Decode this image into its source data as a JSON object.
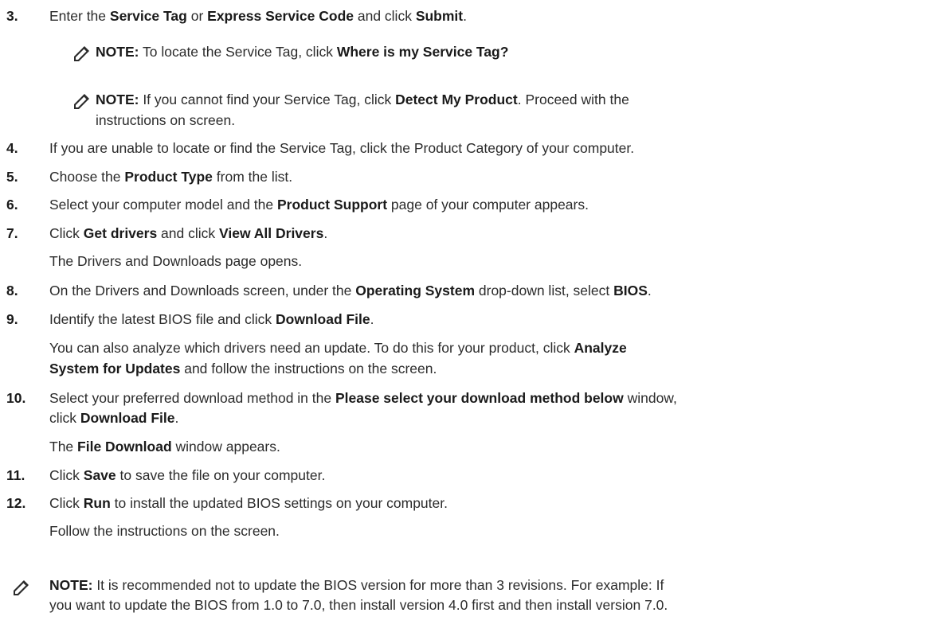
{
  "steps": {
    "s3": {
      "num": "3.",
      "pre": "Enter the ",
      "b1": "Service Tag",
      "mid1": " or ",
      "b2": "Express Service Code",
      "mid2": " and click ",
      "b3": "Submit",
      "post": "."
    },
    "note1": {
      "label": "NOTE:",
      "pre": " To locate the Service Tag, click ",
      "b1": "Where is my Service Tag?"
    },
    "note2": {
      "label": "NOTE:",
      "pre": " If you cannot find your Service Tag, click ",
      "b1": "Detect My Product",
      "post": ". Proceed with the",
      "line2": "instructions on screen."
    },
    "s4": {
      "num": "4.",
      "text": "If you are unable to locate or find the Service Tag, click the Product Category of your computer."
    },
    "s5": {
      "num": "5.",
      "pre": "Choose the ",
      "b1": "Product Type",
      "post": " from the list."
    },
    "s6": {
      "num": "6.",
      "pre": "Select your computer model and the ",
      "b1": "Product Support",
      "post": " page of your computer appears."
    },
    "s7": {
      "num": "7.",
      "pre": "Click ",
      "b1": "Get drivers",
      "mid1": " and click ",
      "b2": "View All Drivers",
      "post": ".",
      "sub": "The Drivers and Downloads page opens."
    },
    "s8": {
      "num": "8.",
      "pre": "On the Drivers and Downloads screen, under the ",
      "b1": "Operating System",
      "mid1": " drop-down list, select ",
      "b2": "BIOS",
      "post": "."
    },
    "s9": {
      "num": "9.",
      "pre": "Identify the latest BIOS file and click ",
      "b1": "Download File",
      "post": ".",
      "sub1_pre": "You can also analyze which drivers need an update. To do this for your product, click ",
      "sub1_b": "Analyze",
      "sub2_b": "System for Updates",
      "sub2_post": " and follow the instructions on the screen."
    },
    "s10": {
      "num": "10.",
      "pre": "Select your preferred download method in the ",
      "b1": "Please select your download method below",
      "post": " window,",
      "line2_pre": "click ",
      "line2_b": "Download File",
      "line2_post": ".",
      "sub_pre": "The ",
      "sub_b": "File Download",
      "sub_post": " window appears."
    },
    "s11": {
      "num": "11.",
      "pre": "Click ",
      "b1": "Save",
      "post": " to save the file on your computer."
    },
    "s12": {
      "num": "12.",
      "pre": "Click ",
      "b1": "Run",
      "post": " to install the updated BIOS settings on your computer.",
      "sub": "Follow the instructions on the screen."
    },
    "note3": {
      "label": "NOTE:",
      "text": " It is recommended not to update the BIOS version for more than 3 revisions. For example: If",
      "line2": "you want to update the BIOS from 1.0 to 7.0, then install version 4.0 first and then install version 7.0."
    }
  },
  "icons": {
    "note": "pencil-note-icon"
  }
}
